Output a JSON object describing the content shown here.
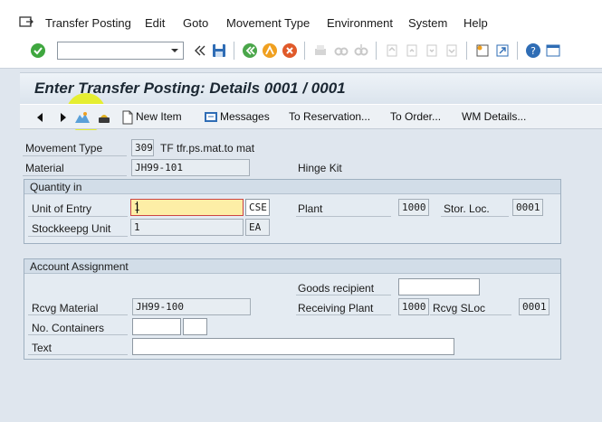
{
  "menu": {
    "items": [
      "Transfer Posting",
      "Edit",
      "Goto",
      "Movement Type",
      "Environment",
      "System",
      "Help"
    ]
  },
  "toolbar": {
    "command_field": "",
    "icons": [
      "enter-icon",
      "save-icon",
      "back-icon",
      "exit-icon",
      "cancel-icon",
      "print-icon",
      "find-icon",
      "find-next-icon",
      "first-page-icon",
      "previous-page-icon",
      "next-page-icon",
      "last-page-icon",
      "new-session-icon",
      "shortcut-icon",
      "help-icon",
      "customize-layout-icon"
    ]
  },
  "title": "Enter Transfer Posting: Details 0001 / 0001",
  "app_toolbar": {
    "new_item": "New Item",
    "messages": "Messages",
    "to_reservation": "To Reservation...",
    "to_order": "To Order...",
    "wm_details": "WM Details..."
  },
  "header": {
    "movement_type_label": "Movement Type",
    "movement_type_code": "309",
    "movement_type_text": "TF tfr.ps.mat.to mat",
    "material_label": "Material",
    "material_value": "JH99-101",
    "material_desc": "Hinge Kit"
  },
  "quantity": {
    "title": "Quantity in",
    "unit_of_entry_label": "Unit of Entry",
    "unit_of_entry_value": "1",
    "unit_of_entry_uom": "CSE",
    "plant_label": "Plant",
    "plant_value": "1000",
    "stor_loc_label": "Stor. Loc.",
    "stor_loc_value": "0001",
    "stockkeeping_label": "Stockkeepg Unit",
    "stockkeeping_value": "1",
    "stockkeeping_uom": "EA"
  },
  "account": {
    "title": "Account Assignment",
    "goods_recipient_label": "Goods recipient",
    "goods_recipient_value": "",
    "rcvg_material_label": "Rcvg Material",
    "rcvg_material_value": "JH99-100",
    "receiving_plant_label": "Receiving Plant",
    "receiving_plant_value": "1000",
    "rcvg_sloc_label": "Rcvg SLoc",
    "rcvg_sloc_value": "0001",
    "no_containers_label": "No. Containers",
    "no_containers_value": "",
    "no_containers_unit": "",
    "text_label": "Text",
    "text_value": ""
  }
}
